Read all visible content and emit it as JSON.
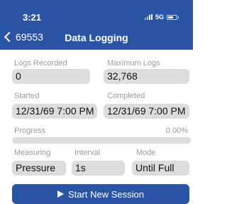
{
  "status_bar": {
    "time": "3:21",
    "network": "5G",
    "battery_level": 0.65
  },
  "nav": {
    "back_label": "69553",
    "title": "Data Logging"
  },
  "logs_recorded": {
    "label": "Logs Recorded",
    "value": "0"
  },
  "maximum_logs": {
    "label": "Maximum Logs",
    "value": "32,768"
  },
  "started": {
    "label": "Started",
    "value": "12/31/69 7:00 PM"
  },
  "completed": {
    "label": "Completed",
    "value": "12/31/69 7:00 PM"
  },
  "progress": {
    "label": "Progress",
    "value_text": "0.00%",
    "fraction": 0.0
  },
  "measuring": {
    "label": "Measuring",
    "value": "Pressure"
  },
  "interval": {
    "label": "Interval",
    "value": "1s"
  },
  "mode": {
    "label": "Mode",
    "value": "Until Full"
  },
  "start_button": {
    "label": "Start New Session",
    "icon": "play-icon"
  },
  "colors": {
    "accent": "#2a55a6",
    "field_bg": "#dcdcdc",
    "label_gray": "#9a9a9a"
  }
}
